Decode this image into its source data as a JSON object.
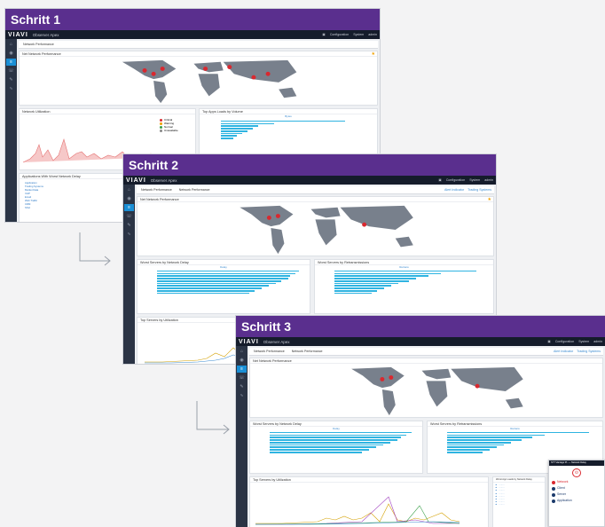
{
  "steps": [
    {
      "heading": "Schritt 1"
    },
    {
      "heading": "Schritt 2"
    },
    {
      "heading": "Schritt 3"
    }
  ],
  "app": {
    "logo": "VIAVI",
    "product": "Observer Apex",
    "top_right": [
      "Configuration",
      "System",
      "admin"
    ]
  },
  "step1": {
    "crumb": "Network Performance",
    "panels": {
      "map": "Net Network Performance",
      "util": "Network Utilization",
      "bars": "Top Apps Loads by Volume",
      "apps": "Applications With Worst Network Delay"
    },
    "legend": [
      "Critical",
      "Warning",
      "Normal",
      "Unavailable"
    ],
    "bars_legend": "Bytes",
    "app_list": [
      "Application",
      "Trading Systems",
      "Market Data",
      "VoIP",
      "Email",
      "Web Traffic",
      "CRM",
      "SSH"
    ]
  },
  "step2": {
    "crumbs": [
      "Network Performance",
      "Network Performance"
    ],
    "filters": [
      "Alert Indicator",
      "Trading Systems"
    ],
    "panels": {
      "map": "Net Network Performance",
      "left": "Worst Servers by Network Delay",
      "right": "Worst Servers by Retransmissions",
      "util": "Top Servers by Utilization"
    },
    "legend_left": "Delay",
    "legend_right": "Retrans"
  },
  "step3": {
    "crumbs": [
      "Network Performance",
      "Network Performance"
    ],
    "filters": [
      "Alert Indicator",
      "Trading Systems"
    ],
    "panels": {
      "map": "Net Network Performance",
      "left": "Worst Servers by Network Delay",
      "right": "Worst Servers by Retransmissions",
      "util": "Top Servers by Utilization",
      "table": "Worst App Loads by Network Delay"
    },
    "legend_left": "Delay",
    "legend_right": "Retrans",
    "popup": {
      "title": "STT Vantage Pt. — Network Delay",
      "items": [
        "Network",
        "Client",
        "Server",
        "Application"
      ]
    }
  },
  "colors": {
    "header": "#5a2f8e",
    "topbar": "#151c2b",
    "bar": "#2fb4e1",
    "critical": "#d9282f"
  }
}
